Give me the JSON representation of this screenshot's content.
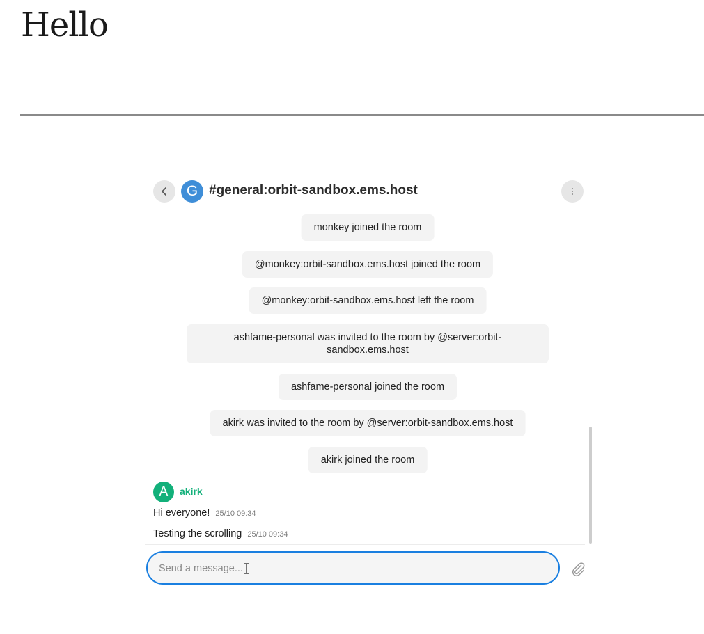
{
  "page": {
    "heading": "Hello"
  },
  "header": {
    "room_avatar_letter": "G",
    "room_name": "#general:orbit-sandbox.ems.host",
    "back_icon": "chevron-left-icon",
    "menu_icon": "vertical-dots-icon"
  },
  "timeline": {
    "events": [
      "monkey joined the room",
      "@monkey:orbit-sandbox.ems.host joined the room",
      "@monkey:orbit-sandbox.ems.host left the room",
      "ashfame-personal was invited to the room by @server:orbit-sandbox.ems.host",
      "ashfame-personal joined the room",
      "akirk was invited to the room by @server:orbit-sandbox.ems.host",
      "akirk joined the room"
    ],
    "sender": {
      "avatar_letter": "A",
      "name": "akirk",
      "color": "#12b07a"
    },
    "messages": [
      {
        "text": "Hi everyone!",
        "time": "25/10 09:34"
      },
      {
        "text": "Testing the scrolling",
        "time": "25/10 09:34"
      }
    ]
  },
  "composer": {
    "placeholder": "Send a message...",
    "attach_icon": "paperclip-icon",
    "focus_color": "#1a7fe0"
  },
  "colors": {
    "room_avatar": "#3f8ed8"
  }
}
